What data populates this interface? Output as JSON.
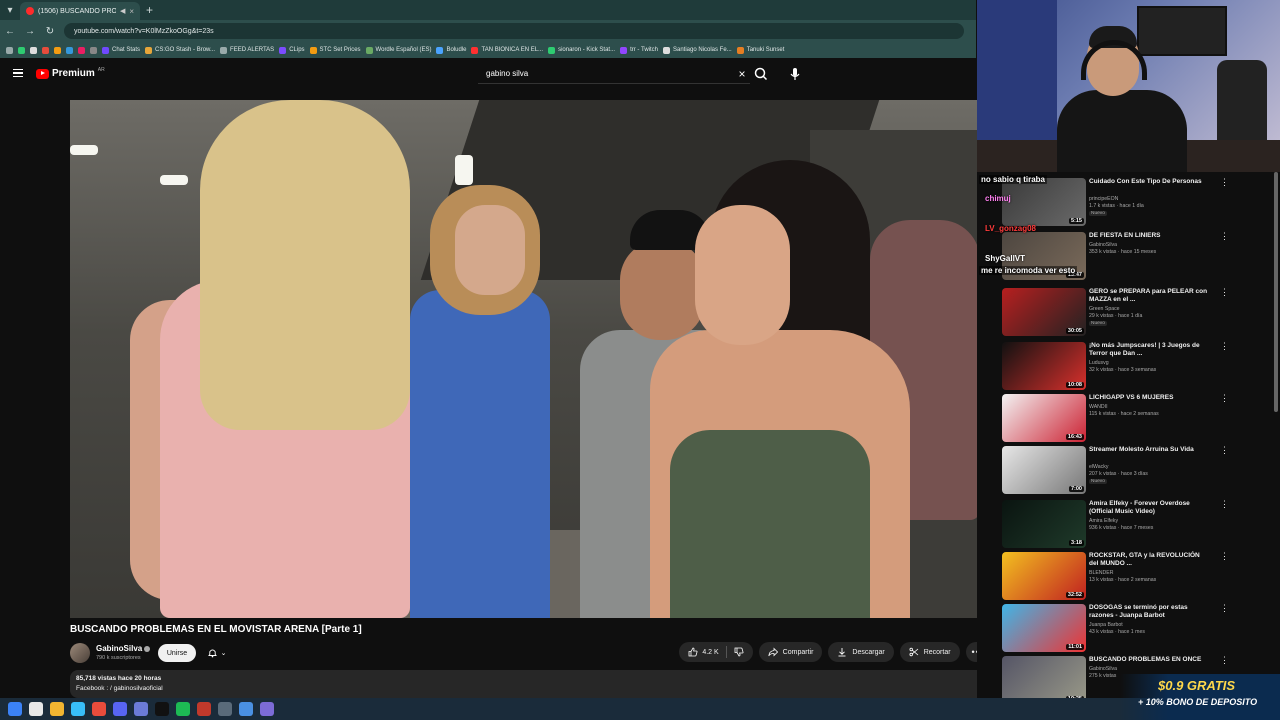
{
  "browser": {
    "tab_title": "(1506) BUSCANDO PROBLE",
    "url": "youtube.com/watch?v=K0lMzZkoOGg&t=23s",
    "bookmarks": [
      {
        "label": "Chat Stats",
        "color": "#6f49ff"
      },
      {
        "label": "CS:GO Stash - Brow...",
        "color": "#e7a63a"
      },
      {
        "label": "FEED ALERTAS",
        "color": "#9aa"
      },
      {
        "label": "CLips",
        "color": "#7b4cff"
      },
      {
        "label": "STC Set Prices",
        "color": "#f39c12"
      },
      {
        "label": "Wordle Español (ES)",
        "color": "#6aaa64"
      },
      {
        "label": "Boludle",
        "color": "#4aa3ff"
      },
      {
        "label": "TAN BIONICA EN EL...",
        "color": "#ff3030"
      },
      {
        "label": "sionaron - Kick Stat...",
        "color": "#2ecc71"
      },
      {
        "label": "trr - Twitch",
        "color": "#9146ff"
      },
      {
        "label": "Santiago Nicolas Fe...",
        "color": "#ddd"
      },
      {
        "label": "Tanuki Sunset",
        "color": "#e67e22"
      }
    ]
  },
  "header": {
    "logo_text": "Premium",
    "logo_country": "AR",
    "search_value": "gabino silva"
  },
  "video": {
    "title": "BUSCANDO PROBLEMAS EN EL MOVISTAR ARENA [Parte 1]",
    "channel": "GabinoSilva",
    "subscribers": "790 k suscriptores",
    "join_label": "Unirse",
    "likes": "4.2 K",
    "share_label": "Compartir",
    "download_label": "Descargar",
    "clip_label": "Recortar",
    "views_line": "85,718 vistas  hace 20 horas",
    "desc_line": "Facebook :  / gabinosilvaoficial"
  },
  "chat": [
    {
      "user": "",
      "text": "no sabio q tiraba",
      "color": "#ffffff"
    },
    {
      "user": "chimuj",
      "text": "",
      "color": "#ff7ff0"
    },
    {
      "user": "LV_gonzag08",
      "text": "",
      "color": "#ff3b3b"
    },
    {
      "user": "ShyGallVT",
      "text": "",
      "color": "#ffffff"
    },
    {
      "user": "",
      "text": "me re incomoda ver esto",
      "color": "#ffffff"
    }
  ],
  "recommendations": [
    {
      "title": "Cuidado Con Este Tipo De Personas",
      "channel": "principeEON",
      "meta": "1.7 k vistas · hace 1 día",
      "badge": "Nuevo",
      "duration": "5:15",
      "colors": [
        "#3a3a3a",
        "#6a6a6a"
      ]
    },
    {
      "title": "DE FIESTA EN LINIERS",
      "channel": "GabinoSilva",
      "meta": "353 k vistas · hace 15 meses",
      "badge": "",
      "duration": "13:47",
      "colors": [
        "#4d4640",
        "#7a6a5a"
      ]
    },
    {
      "title": "GERO se PREPARA para PELEAR con MAZZA en el ...",
      "channel": "Green Space",
      "meta": "29 k vistas · hace 1 día",
      "badge": "Nuevo",
      "duration": "30:05",
      "colors": [
        "#b71f1f",
        "#222"
      ]
    },
    {
      "title": "¡No más Jumpscares! | 3 Juegos de Terror que Dan ...",
      "channel": "Ludusvg",
      "meta": "32 k vistas · hace 3 semanas",
      "badge": "",
      "duration": "10:08",
      "colors": [
        "#111",
        "#d9302c"
      ]
    },
    {
      "title": "LICHIGAPP VS 6 MUJERES",
      "channel": "WANDII",
      "meta": "115 k vistas · hace 2 semanas",
      "badge": "",
      "duration": "16:43",
      "colors": [
        "#f3f3f3",
        "#c23"
      ]
    },
    {
      "title": "Streamer Molesto Arruina Su Vida",
      "channel": "elWacky",
      "meta": "207 k vistas · hace 3 días",
      "badge": "Nuevo",
      "duration": "7:00",
      "colors": [
        "#e7e7e7",
        "#777"
      ]
    },
    {
      "title": "Amira Elfeky - Forever Overdose (Official Music Video)",
      "channel": "Amira Elfeky",
      "meta": "936 k vistas · hace 7 meses",
      "badge": "",
      "duration": "3:18",
      "colors": [
        "#0a1410",
        "#1f3a2a"
      ]
    },
    {
      "title": "ROCKSTAR, GTA y la REVOLUCIÓN del MUNDO ...",
      "channel": "BLENDER",
      "meta": "13 k vistas · hace 2 semanas",
      "badge": "",
      "duration": "32:52",
      "colors": [
        "#f3c020",
        "#c02020"
      ]
    },
    {
      "title": "DOSOGAS se terminó por estas razones - Juanpa Barbot",
      "channel": "Juanpa Barbot",
      "meta": "43 k vistas · hace 1 mes",
      "badge": "",
      "duration": "11:01",
      "colors": [
        "#3fb6e8",
        "#e33"
      ]
    },
    {
      "title": "BUSCANDO PROBLEMAS EN ONCE",
      "channel": "GabinoSilva",
      "meta": "275 k vistas",
      "badge": "",
      "duration": "19:25",
      "colors": [
        "#556",
        "#998"
      ]
    }
  ],
  "promo": {
    "line1": "$0.9 GRATIS",
    "line2": "+ 10% BONO DE DEPOSITO"
  }
}
